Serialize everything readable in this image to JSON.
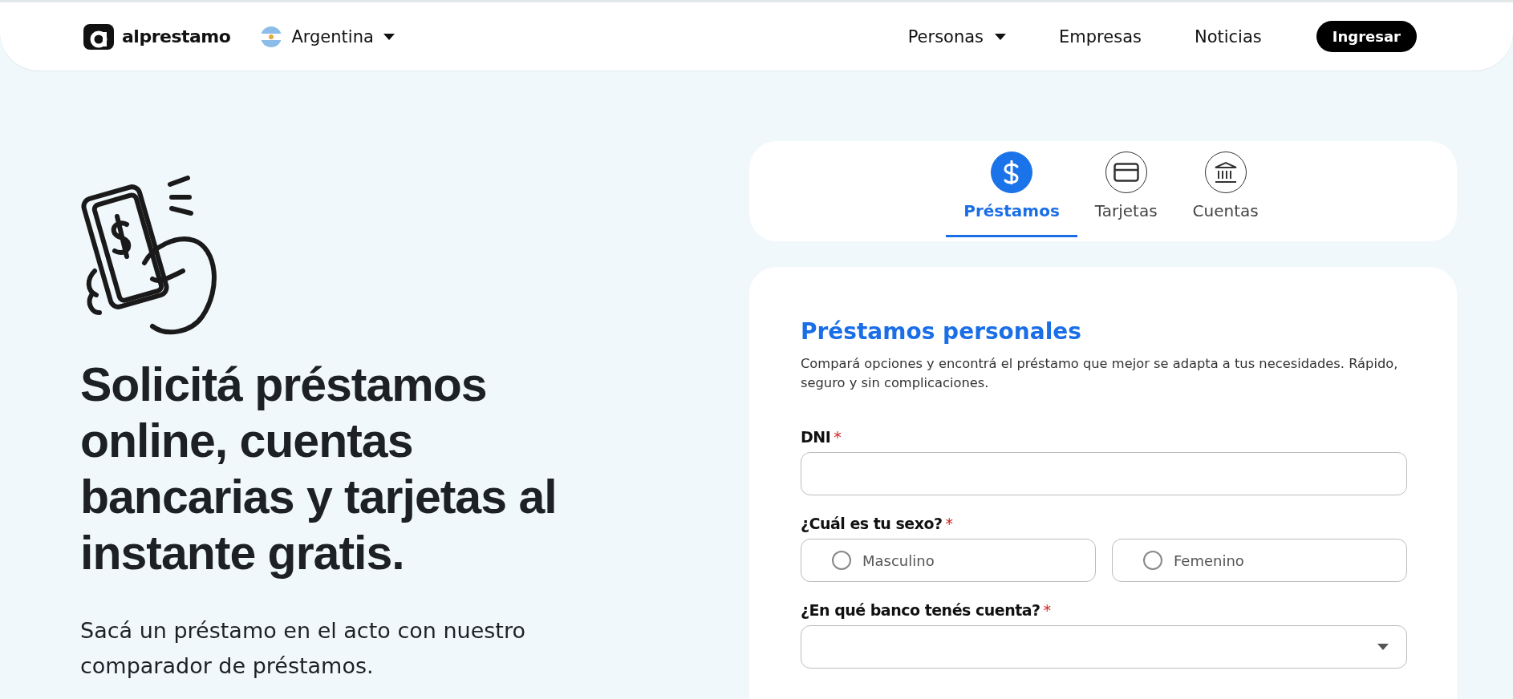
{
  "header": {
    "logo": "alprestamo",
    "country": "Argentina",
    "nav": [
      {
        "label": "Personas",
        "has_menu": true
      },
      {
        "label": "Empresas",
        "has_menu": false
      },
      {
        "label": "Noticias",
        "has_menu": false
      }
    ],
    "login_button": "Ingresar"
  },
  "hero": {
    "headline": "Solicitá préstamos online, cuentas bancarias y tarjetas al instante gratis.",
    "subtitle": "Sacá un préstamo en el acto con nuestro comparador de préstamos."
  },
  "tabs": [
    {
      "label": "Préstamos",
      "kind": "dollar",
      "selected": true
    },
    {
      "label": "Tarjetas",
      "kind": "card",
      "selected": false
    },
    {
      "label": "Cuentas",
      "kind": "bank",
      "selected": false
    }
  ],
  "form": {
    "title": "Préstamos personales",
    "description": "Compará opciones y encontrá el préstamo que mejor se adapta a tus necesidades. Rápido, seguro y sin complicaciones.",
    "fields": [
      {
        "kind": "text",
        "label": "DNI",
        "required": "*"
      },
      {
        "kind": "radio",
        "label": "¿Cuál es tu sexo?",
        "required": "*",
        "options": [
          {
            "label": "Masculino",
            "selected": false
          },
          {
            "label": "Femenino",
            "selected": false
          }
        ]
      },
      {
        "kind": "select",
        "label": "¿En qué banco tenés cuenta?",
        "required": "*"
      }
    ]
  }
}
